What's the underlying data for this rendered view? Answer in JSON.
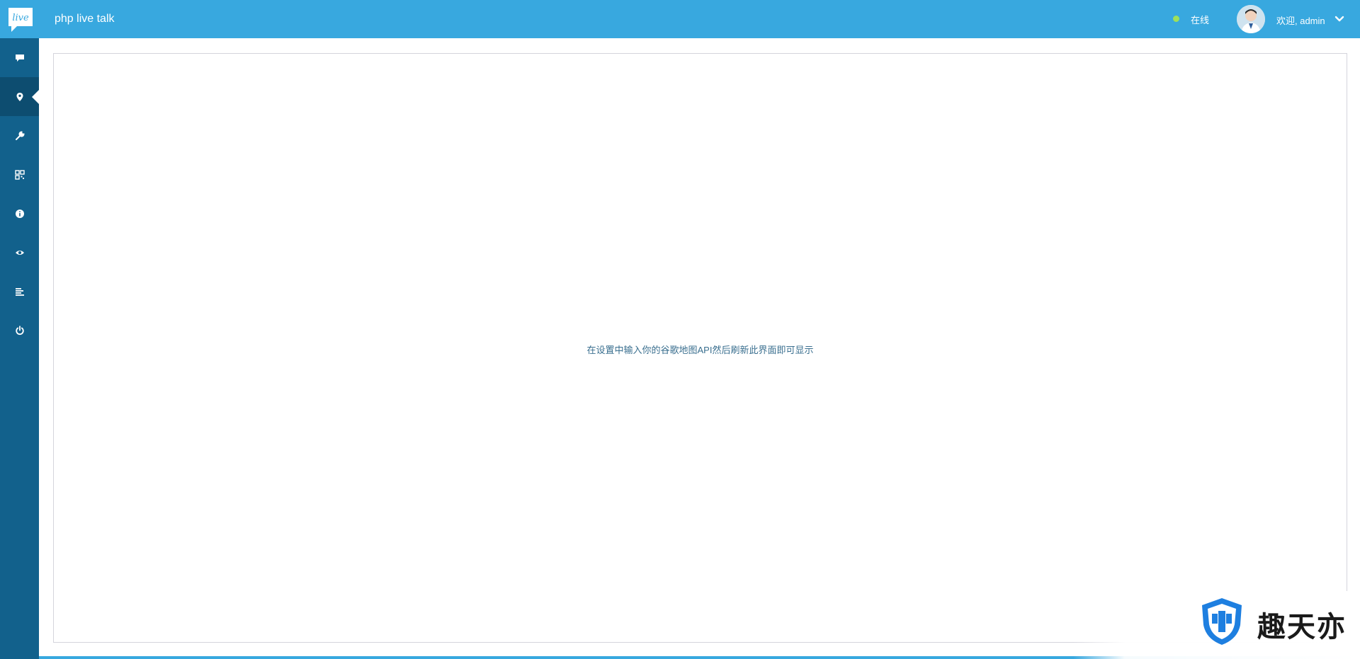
{
  "header": {
    "app_title": "php live talk",
    "logo_text": "live",
    "status_label": "在线",
    "welcome_text": "欢迎, admin"
  },
  "sidebar": {
    "items": [
      {
        "icon": "chat-icon",
        "active": false
      },
      {
        "icon": "map-marker-icon",
        "active": true
      },
      {
        "icon": "wrench-icon",
        "active": false
      },
      {
        "icon": "qrcode-icon",
        "active": false
      },
      {
        "icon": "info-icon",
        "active": false
      },
      {
        "icon": "eye-icon",
        "active": false
      },
      {
        "icon": "align-left-icon",
        "active": false
      },
      {
        "icon": "power-icon",
        "active": false
      }
    ]
  },
  "main": {
    "message": "在设置中输入你的谷歌地图API然后刷新此界面即可显示"
  },
  "watermark": {
    "text": "趣天亦"
  },
  "colors": {
    "topbar": "#38a8df",
    "sidebar": "#12618c",
    "sidebar_active": "#0d4d70",
    "status_online": "#9ee05a",
    "message_text": "#3a6f8f"
  }
}
